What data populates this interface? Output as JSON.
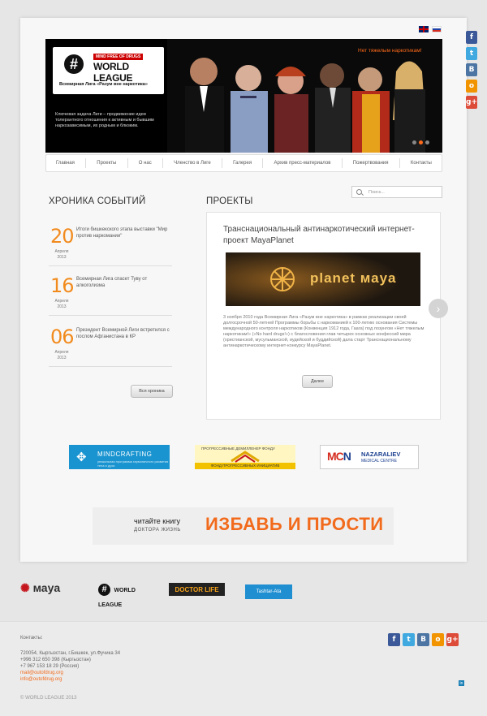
{
  "languages": {
    "en": "English",
    "ru": "Русский"
  },
  "side_social": {
    "icons": [
      "facebook-icon",
      "twitter-icon",
      "vkontakte-icon",
      "odnoklassniki-icon",
      "google-plus-icon"
    ]
  },
  "banner": {
    "logo_tag": "MIND FREE OF DRUGS",
    "logo_name": "WORLD LEAGUE",
    "logo_hash": "#",
    "logo_subtitle": "Всемирная Лига «Разум вне наркотика»",
    "slogan": "Нет тяжелым наркотикам!",
    "text": "Ключевая задача Лиги – продвижение идеи толерантного отношения к активным и бывшим наркозависимым, их родным и близким."
  },
  "nav": {
    "items": [
      "Главная",
      "Проекты",
      "О нас",
      "Членство в Лиге",
      "Галерея",
      "Архив пресс-материалов",
      "Пожертвования",
      "Контакты"
    ]
  },
  "search": {
    "placeholder": "Поиск..."
  },
  "chronicle": {
    "heading": "ХРОНИКА СОБЫТИЙ",
    "events": [
      {
        "day": "20",
        "month": "Апреля",
        "year": "2013",
        "text": "Итоги бишкекского этапа выставки \"Мир против наркомании\""
      },
      {
        "day": "16",
        "month": "Апреля",
        "year": "2013",
        "text": "Всемирная Лига спасет Туву от алкоголизма"
      },
      {
        "day": "06",
        "month": "Апреля",
        "year": "2013",
        "text": "Президент Всемирной Лиги встретился с послом Афганистана в КР"
      }
    ],
    "all_button": "Вся хроника"
  },
  "projects": {
    "heading": "ПРОЕКТЫ",
    "title": "Транснациональный антинаркотический интернет-проект MayaPlanet",
    "image_label": "planet маyа",
    "description": "3 ноября 2010 года Всемирная Лига «Разум вне наркотика» в рамках реализации своей долгосрочной 50-летней Программы борьбы с наркоманией к 100-летию основания Системы международного контроля наркотиков (Конвенция 1912 года, Гаага) под лозунгом «Нет тяжелым наркотикам!» («No hard drugs!») с благословения глав четырех основных конфессий мира (христианской, мусульманской, иудейской и буддийской) дала старт Транснациональному антинаркотическому интернет-конкурсу MayaPlanet.",
    "more_button": "Далее",
    "next_arrow": "›"
  },
  "partners": {
    "mindcrafting_name": "MINDCRAFTING",
    "mindcrafting_sub": "уникальная программа гармоничного развития тела и духа",
    "fund_top": "ПРОГРЕССИВНЫЕ ДЕМИЛЛЕНЕР ФОНДУ",
    "fund_bottom": "ФОНД ПРОГРЕССИВНЫХ ИНИЦИАТИВ",
    "naz_logo_a": "MC",
    "naz_logo_b": "N",
    "naz_name": "NAZARALIEV",
    "naz_sub": "MEDICAL CENTRE"
  },
  "book": {
    "read": "читайте книгу",
    "author": "ДОКТОРА ЖИЗНЬ",
    "title": "ИЗБАВЬ И ПРОСТИ"
  },
  "footer_logos": {
    "maya": "маyа",
    "wl_hash": "#",
    "wl_name": "WORLD LEAGUE",
    "doctorlife": "DOCTOR LIFE",
    "tashtar": "Tashtar-Ata"
  },
  "footer": {
    "contacts_label": "Контакты:",
    "address": "720054, Кыргызстан, г.Бишкек, ул.Фучика 34",
    "phone_kg": "+996 312 650 398 (Кыргызстан)",
    "phone_ru": "+7 967 153 18 29 (Россия)",
    "email_1": "mail@outofdrug.org",
    "email_2": "info@outofdrug.org",
    "copyright": "© WORLD LEAGUE 2013"
  },
  "colors": {
    "accent": "#f26a1b",
    "date": "#f28b1e",
    "nav_border": "#dddddd"
  }
}
